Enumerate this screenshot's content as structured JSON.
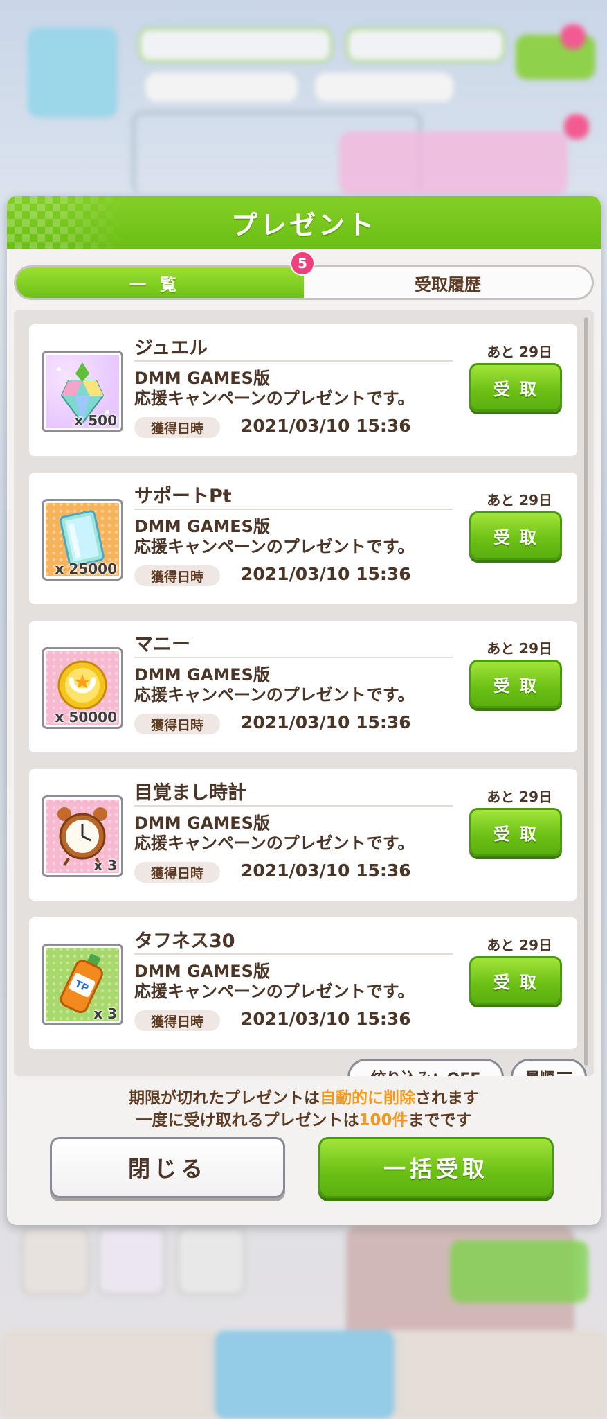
{
  "dialog": {
    "title": "プレゼント",
    "tabs": [
      {
        "label": "一覧",
        "active": true,
        "badge": "5"
      },
      {
        "label": "受取履歴",
        "active": false
      }
    ]
  },
  "items": [
    {
      "name": "ジュエル",
      "icon": "jewel-icon",
      "quantity": "x 500",
      "desc_line1": "DMM GAMES版",
      "desc_line2": "応援キャンペーンのプレゼントです。",
      "date_label": "獲得日時",
      "date": "2021/03/10 15:36",
      "remaining": "あと 29日",
      "button": "受取"
    },
    {
      "name": "サポートPt",
      "icon": "support-card-icon",
      "quantity": "x 25000",
      "desc_line1": "DMM GAMES版",
      "desc_line2": "応援キャンペーンのプレゼントです。",
      "date_label": "獲得日時",
      "date": "2021/03/10 15:36",
      "remaining": "あと 29日",
      "button": "受取"
    },
    {
      "name": "マニー",
      "icon": "coin-icon",
      "quantity": "x 50000",
      "desc_line1": "DMM GAMES版",
      "desc_line2": "応援キャンペーンのプレゼントです。",
      "date_label": "獲得日時",
      "date": "2021/03/10 15:36",
      "remaining": "あと 29日",
      "button": "受取"
    },
    {
      "name": "目覚まし時計",
      "icon": "alarm-clock-icon",
      "quantity": "x 3",
      "desc_line1": "DMM GAMES版",
      "desc_line2": "応援キャンペーンのプレゼントです。",
      "date_label": "獲得日時",
      "date": "2021/03/10 15:36",
      "remaining": "あと 29日",
      "button": "受取"
    },
    {
      "name": "タフネス30",
      "icon": "tp-bottle-icon",
      "quantity": "x 3",
      "desc_line1": "DMM GAMES版",
      "desc_line2": "応援キャンペーンのプレゼントです。",
      "date_label": "獲得日時",
      "date": "2021/03/10 15:36",
      "remaining": "あと 29日",
      "button": "受取"
    }
  ],
  "filter": {
    "label": "絞り込み：OFF",
    "sort_label": "昇順"
  },
  "notice": {
    "line1_a": "期限が切れたプレゼントは",
    "line1_hl": "自動的に削除",
    "line1_b": "されます",
    "line2_a": "一度に受け取れるプレゼントは",
    "line2_hl": "100件",
    "line2_b": "までです"
  },
  "footer": {
    "close_label": "閉じる",
    "bulk_label": "一括受取"
  },
  "colors": {
    "accent_green": "#6bbf14",
    "badge_pink": "#f23f7e",
    "highlight_orange": "#f29a1e",
    "text_brown": "#4a3526"
  }
}
